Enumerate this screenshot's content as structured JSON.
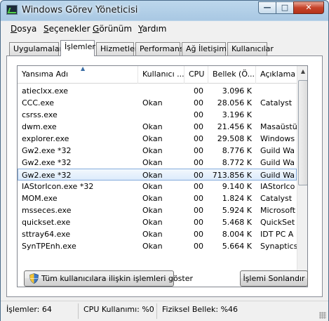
{
  "window": {
    "title": "Windows Görev Yöneticisi"
  },
  "controls": {
    "minimize": "—",
    "maximize": "□",
    "close": "✕"
  },
  "menu": [
    "Dosya",
    "Seçenekler",
    "Görünüm",
    "Yardım"
  ],
  "tabs": [
    "Uygulamalar",
    "İşlemler",
    "Hizmetler",
    "Performans",
    "Ağ İletişimi",
    "Kullanıcılar"
  ],
  "active_tab": "İşlemler",
  "columns": [
    "Yansıma Adı",
    "Kullanıcı ...",
    "CPU",
    "Bellek (Ö...",
    "Açıklama"
  ],
  "processes": [
    {
      "name": "atieclxx.exe",
      "user": "",
      "cpu": "00",
      "mem": "3.096 K",
      "desc": ""
    },
    {
      "name": "CCC.exe",
      "user": "Okan",
      "cpu": "00",
      "mem": "28.056 K",
      "desc": "Catalyst"
    },
    {
      "name": "csrss.exe",
      "user": "",
      "cpu": "00",
      "mem": "3.196 K",
      "desc": ""
    },
    {
      "name": "dwm.exe",
      "user": "Okan",
      "cpu": "00",
      "mem": "21.456 K",
      "desc": "Masaüstü"
    },
    {
      "name": "explorer.exe",
      "user": "Okan",
      "cpu": "00",
      "mem": "29.508 K",
      "desc": "Windows"
    },
    {
      "name": "Gw2.exe *32",
      "user": "Okan",
      "cpu": "00",
      "mem": "8.776 K",
      "desc": "Guild Wa"
    },
    {
      "name": "Gw2.exe *32",
      "user": "Okan",
      "cpu": "00",
      "mem": "8.772 K",
      "desc": "Guild Wa"
    },
    {
      "name": "Gw2.exe *32",
      "user": "Okan",
      "cpu": "00",
      "mem": "713.856 K",
      "desc": "Guild Wa"
    },
    {
      "name": "IAStorIcon.exe *32",
      "user": "Okan",
      "cpu": "00",
      "mem": "9.140 K",
      "desc": "IAStorIco"
    },
    {
      "name": "MOM.exe",
      "user": "Okan",
      "cpu": "00",
      "mem": "1.824 K",
      "desc": "Catalyst"
    },
    {
      "name": "msseces.exe",
      "user": "Okan",
      "cpu": "00",
      "mem": "5.924 K",
      "desc": "Microsoft"
    },
    {
      "name": "quickset.exe",
      "user": "Okan",
      "cpu": "00",
      "mem": "5.468 K",
      "desc": "QuickSet"
    },
    {
      "name": "sttray64.exe",
      "user": "Okan",
      "cpu": "00",
      "mem": "8.004 K",
      "desc": "IDT PC A"
    },
    {
      "name": "SynTPEnh.exe",
      "user": "Okan",
      "cpu": "00",
      "mem": "5.664 K",
      "desc": "Synaptics"
    }
  ],
  "selected_row": "Gw2.exe *32 — 713.856 K",
  "buttons": {
    "show_all": "Tüm kullanıcılara ilişkin işlemleri göster",
    "end_process": "İşlemi Sonlandır"
  },
  "status": {
    "processes": "İşlemler: 64",
    "cpu": "CPU Kullanımı: %0",
    "memory": "Fiziksel Bellek: %46"
  },
  "icons": [
    "task-manager-app-icon",
    "shield-icon",
    "sort-ascending-icon",
    "scroll-up-icon",
    "scroll-down-icon"
  ],
  "colors": {
    "selection": "#dcebfb",
    "selection_border": "#84acdd",
    "title_gradient": "#a9c8e3"
  }
}
